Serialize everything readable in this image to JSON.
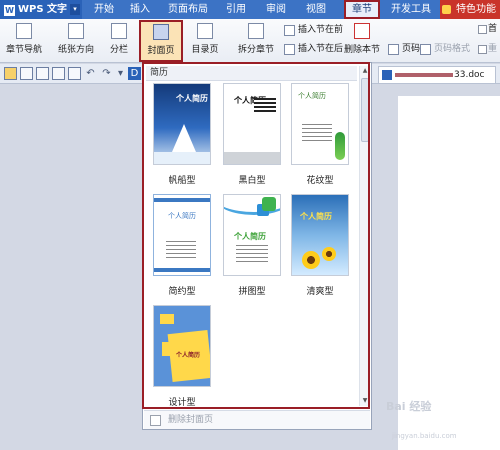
{
  "app": {
    "name": "WPS 文字",
    "logo_letter": "W",
    "menu_arrow": "▾"
  },
  "tabs": [
    {
      "label": "开始"
    },
    {
      "label": "插入"
    },
    {
      "label": "页面布局"
    },
    {
      "label": "引用"
    },
    {
      "label": "审阅"
    },
    {
      "label": "视图"
    },
    {
      "label": "章节",
      "active": true
    },
    {
      "label": "开发工具"
    },
    {
      "label": "特色功能"
    }
  ],
  "ribbon": {
    "chapter_nav": "章节导航",
    "page_orientation": "纸张方向",
    "columns": "分栏",
    "cover_page": "封面页",
    "toc_page": "目录页",
    "split_chapter": "拆分章节",
    "insert_section_before": "插入节在前",
    "insert_section_after": "插入节在后",
    "delete_section": "删除本节",
    "page_number": "页码",
    "page_number_format": "页码格式",
    "first_page_different": "首",
    "restart_numbering": "重"
  },
  "document": {
    "tab_suffix": "33.doc"
  },
  "cover_panel": {
    "header": "简历",
    "footer": "删除封面页",
    "templates": [
      {
        "name": "帆船型",
        "title": "个人简历"
      },
      {
        "name": "黑白型",
        "title": "个人简历"
      },
      {
        "name": "花纹型",
        "title": "个人简历"
      },
      {
        "name": "简约型",
        "title": "个人简历"
      },
      {
        "name": "拼图型",
        "title": "个人简历"
      },
      {
        "name": "清爽型",
        "title": "个人简历"
      },
      {
        "name": "设计型",
        "title": "个人简历"
      }
    ]
  },
  "watermark": {
    "brand": "Bai 经验",
    "url": "jingyan.baidu.com"
  },
  "colors": {
    "title_bar": "#3c73c5",
    "highlight_border": "#9a1e26",
    "ribbon_bg": "#f3f5f9"
  }
}
